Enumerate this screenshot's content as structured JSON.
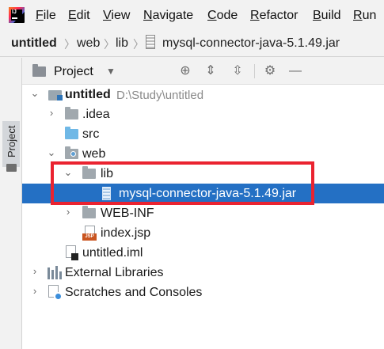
{
  "menubar": {
    "items": [
      "File",
      "Edit",
      "View",
      "Navigate",
      "Code",
      "Refactor",
      "Build",
      "Run"
    ],
    "underline": [
      "F",
      "E",
      "V",
      "N",
      "C",
      "R",
      "B",
      "R"
    ]
  },
  "breadcrumb": {
    "items": [
      "untitled",
      "web",
      "lib",
      "mysql-connector-java-5.1.49.jar"
    ]
  },
  "toolstrip": {
    "label": "Project"
  },
  "panel": {
    "title": "Project",
    "dropdown_icon": "chevron-down-icon",
    "tools": [
      "locate-icon",
      "expand-all-icon",
      "collapse-all-icon",
      "gear-icon",
      "minimize-icon"
    ]
  },
  "tree": {
    "root": {
      "label": "untitled",
      "path": "D:\\Study\\untitled"
    },
    "idea": "idea-folder",
    "idea_label": ".idea",
    "src_label": "src",
    "web_label": "web",
    "lib_label": "lib",
    "jar_label": "mysql-connector-java-5.1.49.jar",
    "webinf_label": "WEB-INF",
    "indexjsp_label": "index.jsp",
    "iml_label": "untitled.iml",
    "extlibs_label": "External Libraries",
    "scratches_label": "Scratches and Consoles"
  },
  "colors": {
    "selection": "#2470c4",
    "highlight_border": "#ea2330",
    "panel_bg": "#ffffff",
    "chrome_bg": "#f2f2f2"
  }
}
